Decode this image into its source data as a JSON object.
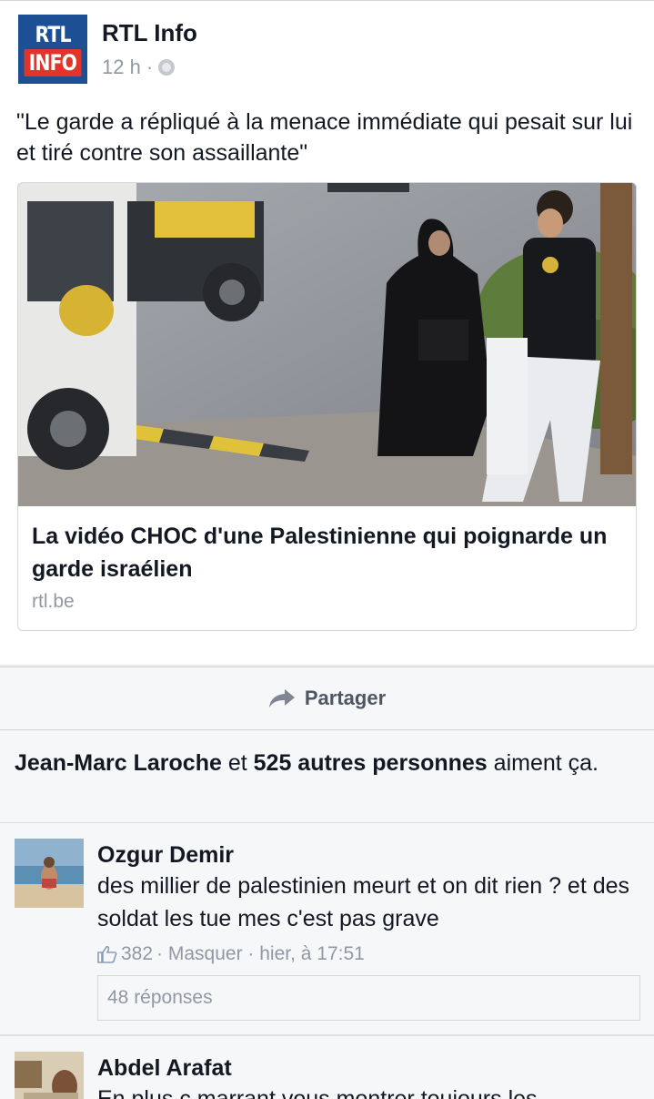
{
  "post": {
    "logo_line1": "RTL",
    "logo_line2": "INFO",
    "page_name": "RTL Info",
    "time": "12 h ·",
    "text": "\"Le garde a répliqué à la menace immédiate qui pesait sur lui et tiré contre son assaillante\"",
    "link": {
      "title": "La vidéo CHOC d'une Palestinienne qui poignarde un garde israélien",
      "domain": "rtl.be"
    },
    "share_label": "Partager"
  },
  "likes": {
    "name": "Jean-Marc Laroche",
    "connector": "et",
    "others": "525 autres personnes",
    "suffix": "aiment ça."
  },
  "comments": [
    {
      "name": "Ozgur Demir",
      "text": "des millier de palestinien meurt et on dit rien ? et des soldat les tue mes c'est pas grave",
      "like_count": "382",
      "meta": "· Masquer · hier, à 17:51",
      "replies": "48 réponses"
    },
    {
      "name": "Abdel Arafat",
      "text": "En plus c marrant vous montrer toujours les"
    }
  ],
  "colors": {
    "brand_blue": "#1d4f94",
    "brand_red": "#e2342a",
    "meta_gray": "#9197a3"
  }
}
